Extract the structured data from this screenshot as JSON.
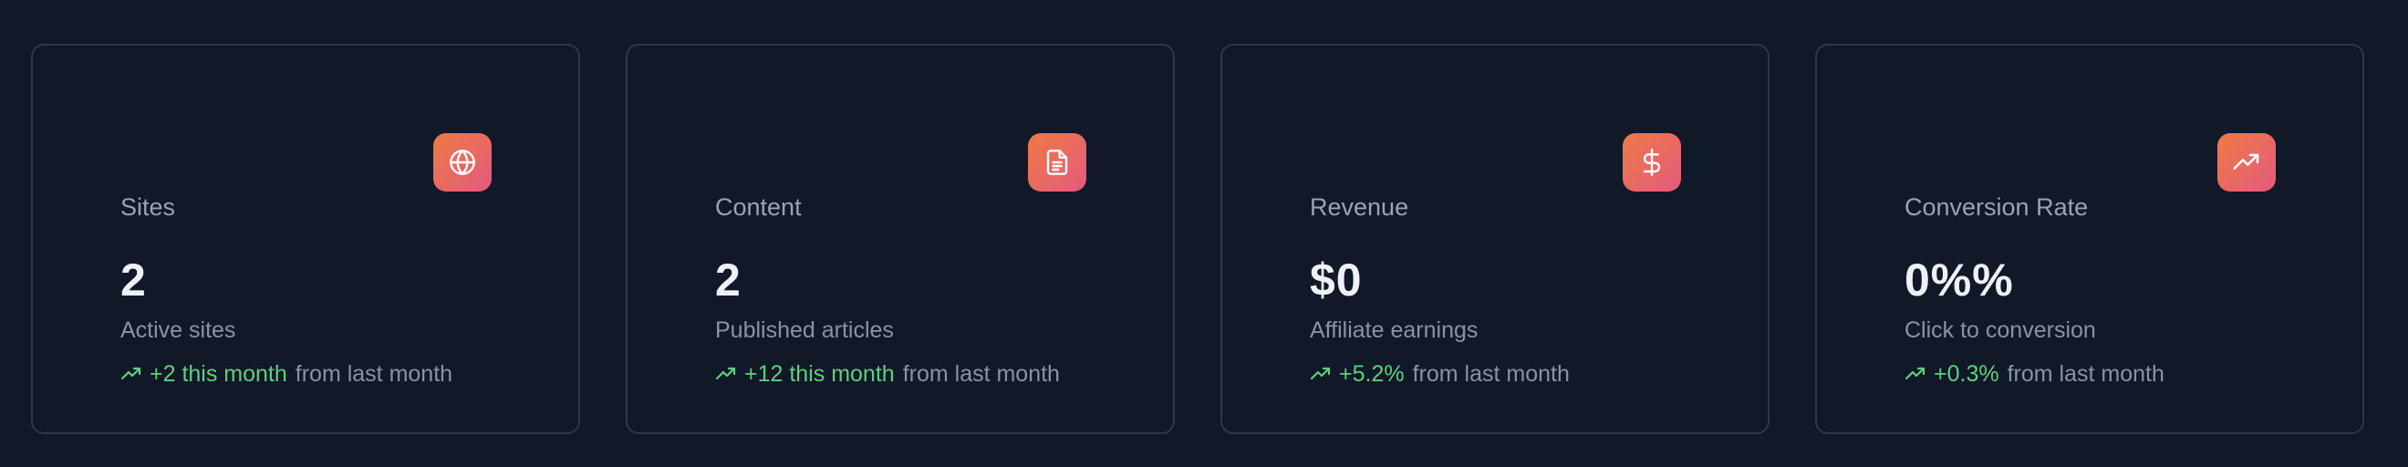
{
  "colors": {
    "background": "#111827",
    "card_border": "#2d3847",
    "icon_gradient_start": "#ee7a45",
    "icon_gradient_end": "#e45a7e",
    "trend_positive": "#5fcf7e",
    "muted_text": "#8a93a2",
    "value_text": "#eef1f6"
  },
  "cards": [
    {
      "title": "Sites",
      "icon": "globe-icon",
      "value": "2",
      "description": "Active sites",
      "trend_value": "+2 this month",
      "trend_suffix": "from last month"
    },
    {
      "title": "Content",
      "icon": "document-icon",
      "value": "2",
      "description": "Published articles",
      "trend_value": "+12 this month",
      "trend_suffix": "from last month"
    },
    {
      "title": "Revenue",
      "icon": "dollar-icon",
      "value": "$0",
      "description": "Affiliate earnings",
      "trend_value": "+5.2%",
      "trend_suffix": "from last month"
    },
    {
      "title": "Conversion Rate",
      "icon": "trending-up-icon",
      "value": "0%%",
      "description": "Click to conversion",
      "trend_value": "+0.3%",
      "trend_suffix": "from last month"
    }
  ]
}
